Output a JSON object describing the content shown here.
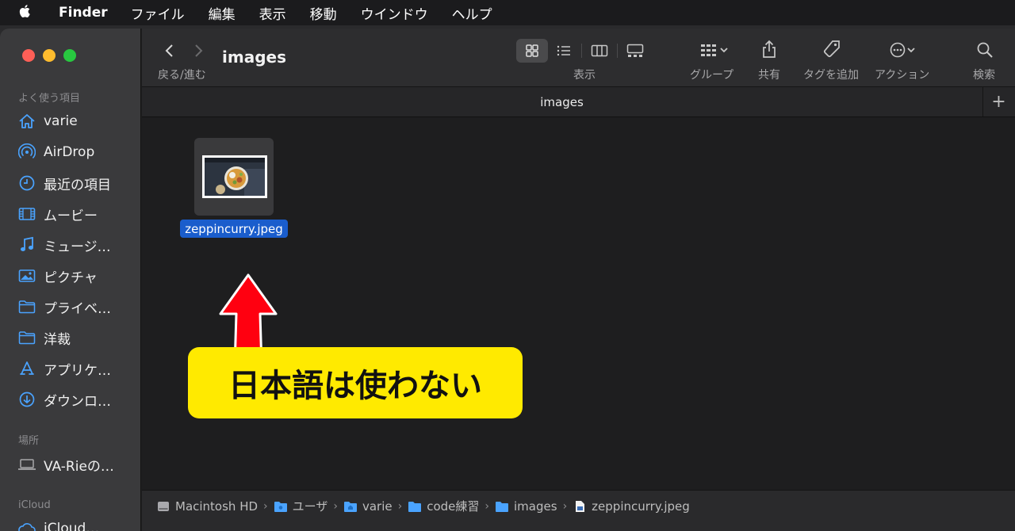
{
  "menubar": {
    "app": "Finder",
    "items": [
      "ファイル",
      "編集",
      "表示",
      "移動",
      "ウインドウ",
      "ヘルプ"
    ]
  },
  "sidebar": {
    "favorites_header": "よく使う項目",
    "favorites": [
      {
        "label": "varie",
        "icon": "home-icon"
      },
      {
        "label": "AirDrop",
        "icon": "airdrop-icon"
      },
      {
        "label": "最近の項目",
        "icon": "clock-icon"
      },
      {
        "label": "ムービー",
        "icon": "film-icon"
      },
      {
        "label": "ミュージ…",
        "icon": "music-icon"
      },
      {
        "label": "ピクチャ",
        "icon": "photo-icon"
      },
      {
        "label": "プライベ…",
        "icon": "folder-icon"
      },
      {
        "label": "洋裁",
        "icon": "folder-icon"
      },
      {
        "label": "アプリケ…",
        "icon": "apps-icon"
      },
      {
        "label": "ダウンロ…",
        "icon": "download-icon"
      }
    ],
    "locations_header": "場所",
    "locations": [
      {
        "label": "VA-Rieの…",
        "icon": "laptop-icon"
      }
    ],
    "icloud_header": "iCloud",
    "icloud": [
      {
        "label": "iCloud…",
        "icon": "cloud-icon"
      }
    ]
  },
  "toolbar": {
    "title": "images",
    "back_forward_label": "戻る/進む",
    "view_label": "表示",
    "group_label": "グループ",
    "share_label": "共有",
    "tag_label": "タグを追加",
    "action_label": "アクション",
    "search_label": "検索"
  },
  "tab": {
    "label": "images"
  },
  "file": {
    "name": "zeppincurry.jpeg"
  },
  "callout": {
    "text": "日本語は使わない"
  },
  "pathbar": {
    "items": [
      "Macintosh HD",
      "ユーザ",
      "varie",
      "code練習",
      "images",
      "zeppincurry.jpeg"
    ]
  },
  "colors": {
    "accent": "#1a5dcc",
    "sidebar_icon": "#4aa3ff",
    "callout_bg": "#ffea00",
    "arrow": "#ff0010"
  }
}
